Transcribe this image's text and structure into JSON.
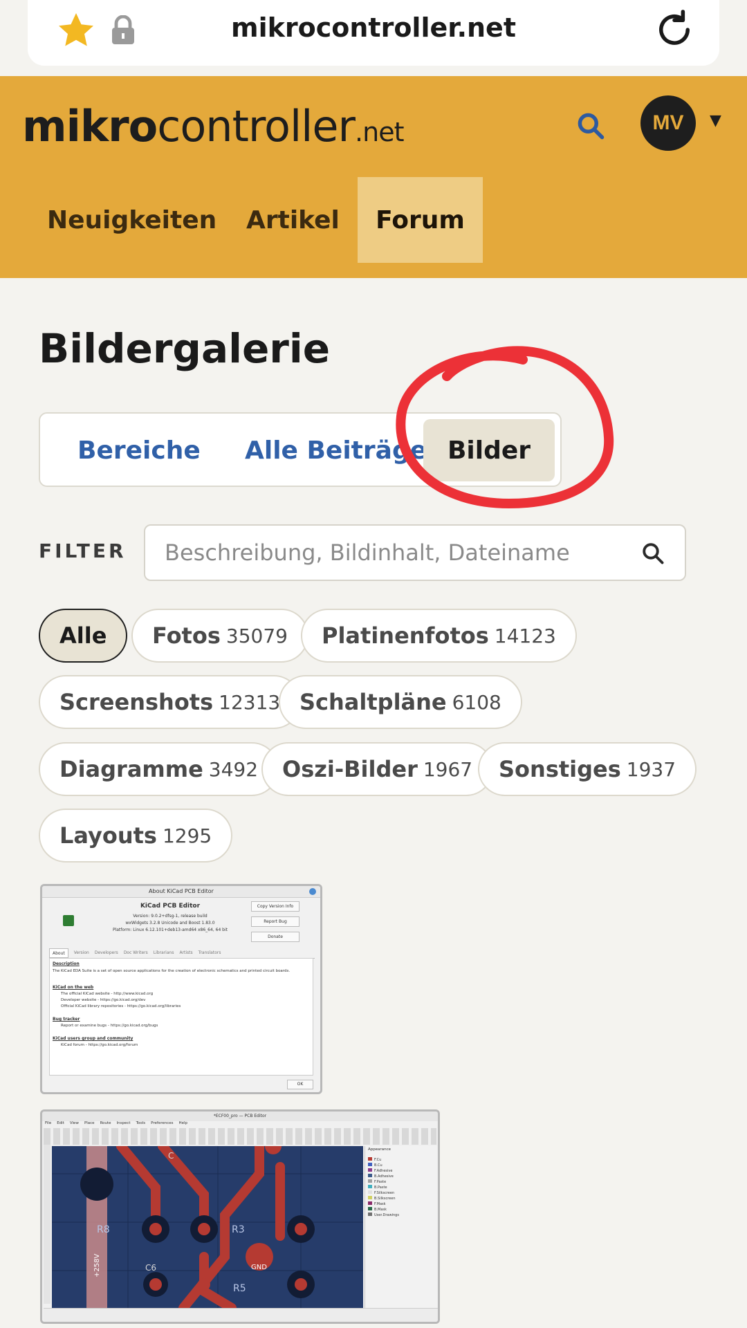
{
  "browser": {
    "url": "mikrocontroller.net"
  },
  "header": {
    "logo_bold": "mikro",
    "logo_rest": "controller",
    "logo_net": ".net",
    "avatar": "MV",
    "nav": [
      {
        "label": "Neuigkeiten"
      },
      {
        "label": "Artikel"
      },
      {
        "label": "Forum"
      }
    ]
  },
  "main": {
    "title": "Bildergalerie",
    "tabs": [
      {
        "label": "Bereiche"
      },
      {
        "label": "Alle Beiträge"
      },
      {
        "label": "Bilder"
      }
    ],
    "filter_label": "FILTER",
    "filter_placeholder": "Beschreibung, Bildinhalt, Dateiname",
    "chips": [
      {
        "label": "Alle",
        "count": ""
      },
      {
        "label": "Fotos",
        "count": "35079"
      },
      {
        "label": "Platinenfotos",
        "count": "14123"
      },
      {
        "label": "Screenshots",
        "count": "12313"
      },
      {
        "label": "Schaltpläne",
        "count": "6108"
      },
      {
        "label": "Diagramme",
        "count": "3492"
      },
      {
        "label": "Oszi-Bilder",
        "count": "1967"
      },
      {
        "label": "Sonstiges",
        "count": "1937"
      },
      {
        "label": "Layouts",
        "count": "1295"
      }
    ]
  },
  "thumb1": {
    "window_title": "About KiCad PCB Editor",
    "app_name": "KiCad PCB Editor",
    "version": "Version: 9.0.2+dfsg-1, release build",
    "wx": "wxWidgets 3.2.8 Unicode and Boost 1.83.0",
    "platform": "Platform: Linux 6.12.101+deb13-amd64 x86_64, 64 bit",
    "btn_copy": "Copy Version Info",
    "btn_report": "Report Bug",
    "btn_donate": "Donate",
    "tabs": [
      "About",
      "Version",
      "Developers",
      "Doc Writers",
      "Librarians",
      "Artists",
      "Translators"
    ],
    "desc_head": "Description",
    "desc": "The KiCad EDA Suite is a set of open source applications for the creation of electronic schematics and printed circuit boards.",
    "web_head": "KiCad on the web",
    "web1": "The official KiCad website - http://www.kicad.org",
    "web2": "Developer website - https://go.kicad.org/dev",
    "web3": "Official KiCad library repositories - https://go.kicad.org/libraries",
    "bug_head": "Bug tracker",
    "bug1": "Report or examine bugs - https://go.kicad.org/bugs",
    "users_head": "KiCad users group and community",
    "users1": "KiCad forum - https://go.kicad.org/forum",
    "ok": "OK"
  },
  "thumb2": {
    "window_title": "*ECF00_pro — PCB Editor",
    "menu": [
      "File",
      "Edit",
      "View",
      "Place",
      "Route",
      "Inspect",
      "Tools",
      "Preferences",
      "Help"
    ],
    "labels": [
      "R8",
      "C6",
      "R3",
      "R5",
      "GND",
      "+258V",
      "C"
    ],
    "panel_title": "Appearance",
    "layers": [
      "F.Cu",
      "B.Cu",
      "F.Adhesive",
      "B.Adhesive",
      "F.Paste",
      "B.Paste",
      "F.Silkscreen",
      "B.Silkscreen",
      "F.Mask",
      "B.Mask",
      "User.Drawings"
    ]
  },
  "colors": {
    "header": "#e4a93b",
    "nav_active": "#eecc84",
    "link": "#3060a8",
    "annotation": "#e8393a",
    "pcb_bg": "#263c6a",
    "track": "#b53a32"
  }
}
